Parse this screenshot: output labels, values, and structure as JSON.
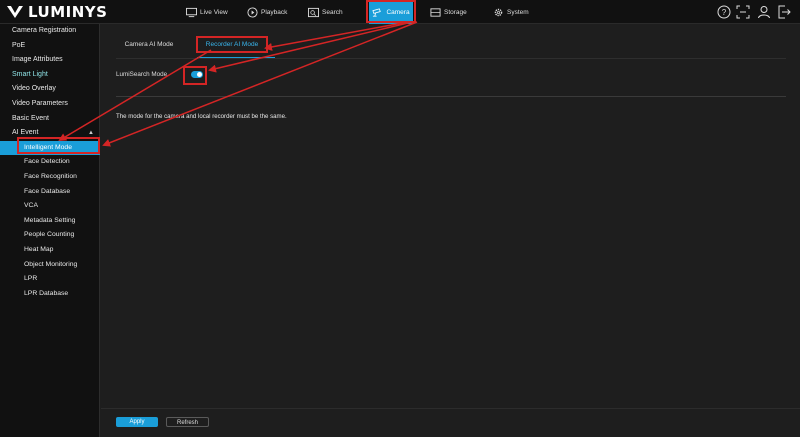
{
  "brand": {
    "name": "LUMINYS"
  },
  "nav": {
    "items": [
      {
        "label": "Live View",
        "icon": "monitor-icon"
      },
      {
        "label": "Playback",
        "icon": "playback-icon"
      },
      {
        "label": "Search",
        "icon": "search-icon"
      },
      {
        "label": "Camera",
        "icon": "camera-icon",
        "active": true
      },
      {
        "label": "Storage",
        "icon": "storage-icon"
      },
      {
        "label": "System",
        "icon": "gear-icon"
      }
    ],
    "right_icons": [
      "help-icon",
      "fullscreen-icon",
      "user-icon",
      "logout-icon"
    ]
  },
  "sidebar": {
    "items": [
      {
        "label": "Camera Registration"
      },
      {
        "label": "PoE"
      },
      {
        "label": "Image Attributes"
      },
      {
        "label": "Smart Light"
      },
      {
        "label": "Video Overlay"
      },
      {
        "label": "Video Parameters"
      },
      {
        "label": "Basic Event"
      },
      {
        "label": "AI Event",
        "expanded": true
      },
      {
        "label": "Intelligent Mode",
        "active": true
      },
      {
        "label": "Face Detection"
      },
      {
        "label": "Face Recognition"
      },
      {
        "label": "Face Database"
      },
      {
        "label": "VCA"
      },
      {
        "label": "Metadata Setting"
      },
      {
        "label": "People Counting"
      },
      {
        "label": "Heat Map"
      },
      {
        "label": "Object Monitoring"
      },
      {
        "label": "LPR"
      },
      {
        "label": "LPR Database"
      }
    ],
    "caret": "▲"
  },
  "main": {
    "tabs": [
      {
        "label": "Camera AI Mode"
      },
      {
        "label": "Recorder AI Mode",
        "active": true
      }
    ],
    "lumisearch_label": "LumiSearch Mode",
    "lumisearch_on": true,
    "note": "The mode for the camera and local recorder must be the same.",
    "apply_label": "Apply",
    "refresh_label": "Refresh"
  },
  "colors": {
    "accent": "#1a9ed9",
    "annotation": "#d42525",
    "sidebar_bg": "#111111",
    "content_bg": "#1e1e1e"
  }
}
